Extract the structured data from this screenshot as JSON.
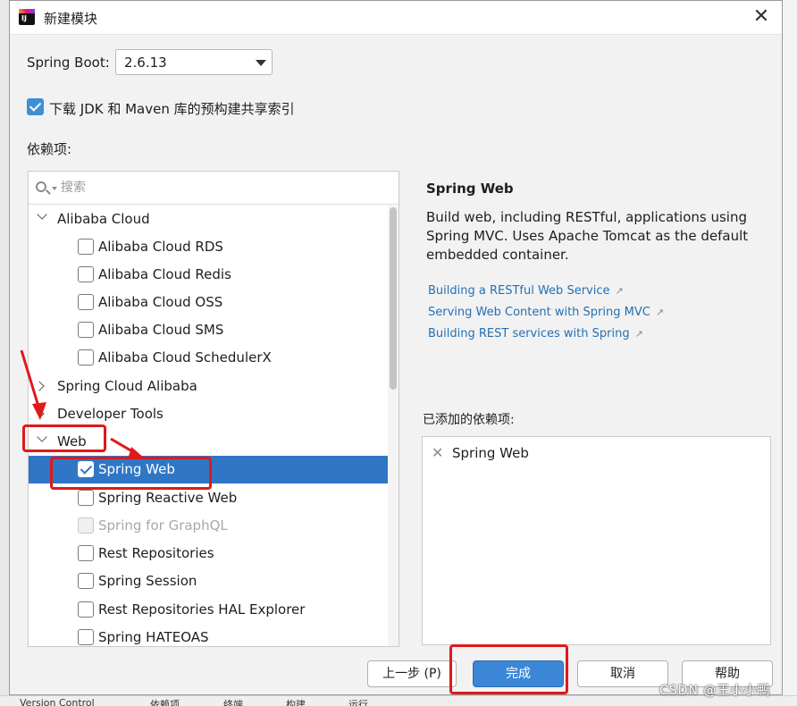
{
  "window": {
    "title": "新建模块",
    "app_icon": "intellij-idea-icon"
  },
  "spring_boot": {
    "label": "Spring Boot:",
    "value": "2.6.13"
  },
  "download_index": {
    "label": "下载 JDK 和 Maven 库的预构建共享索引",
    "checked": true
  },
  "dependencies_label": "依赖项:",
  "search": {
    "placeholder": "搜索"
  },
  "tree": [
    {
      "type": "group",
      "label": "Alibaba Cloud",
      "expanded": true
    },
    {
      "type": "item",
      "label": "Alibaba Cloud RDS",
      "checked": false
    },
    {
      "type": "item",
      "label": "Alibaba Cloud Redis",
      "checked": false
    },
    {
      "type": "item",
      "label": "Alibaba Cloud OSS",
      "checked": false
    },
    {
      "type": "item",
      "label": "Alibaba Cloud SMS",
      "checked": false
    },
    {
      "type": "item",
      "label": "Alibaba Cloud SchedulerX",
      "checked": false
    },
    {
      "type": "group",
      "label": "Spring Cloud Alibaba",
      "expanded": false
    },
    {
      "type": "group",
      "label": "Developer Tools",
      "expanded": false
    },
    {
      "type": "group",
      "label": "Web",
      "expanded": true
    },
    {
      "type": "item",
      "label": "Spring Web",
      "checked": true,
      "selected": true
    },
    {
      "type": "item",
      "label": "Spring Reactive Web",
      "checked": false
    },
    {
      "type": "item",
      "label": "Spring for GraphQL",
      "checked": false,
      "disabled": true
    },
    {
      "type": "item",
      "label": "Rest Repositories",
      "checked": false
    },
    {
      "type": "item",
      "label": "Spring Session",
      "checked": false
    },
    {
      "type": "item",
      "label": "Rest Repositories HAL Explorer",
      "checked": false
    },
    {
      "type": "item",
      "label": "Spring HATEOAS",
      "checked": false
    }
  ],
  "detail": {
    "title": "Spring Web",
    "description": "Build web, including RESTful, applications using Spring MVC. Uses Apache Tomcat as the default embedded container.",
    "links": [
      "Building a RESTful Web Service",
      "Serving Web Content with Spring MVC",
      "Building REST services with Spring"
    ]
  },
  "added": {
    "label": "已添加的依赖项:",
    "items": [
      "Spring Web"
    ]
  },
  "buttons": {
    "prev": "上一步 (P)",
    "finish": "完成",
    "cancel": "取消",
    "help": "帮助"
  },
  "bottom_bar": [
    "Version Control",
    "依赖项",
    "终端",
    "构建",
    "运行"
  ],
  "watermark": "CSDN @王小小鸭",
  "colors": {
    "selection": "#2f77c5",
    "primary_button": "#3b86d6",
    "annotation": "#e01919",
    "link": "#2470b3"
  }
}
